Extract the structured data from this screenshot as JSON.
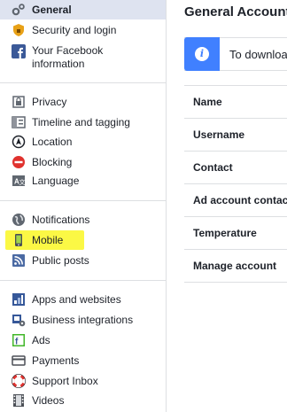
{
  "sidebar": {
    "groups": [
      [
        {
          "label": "General",
          "icon": "gear-icon",
          "selected": true
        },
        {
          "label": "Security and login",
          "icon": "shield-icon"
        },
        {
          "label": "Your Facebook\ninformation",
          "icon": "facebook-icon"
        }
      ],
      [
        {
          "label": "Privacy",
          "icon": "lock-icon"
        },
        {
          "label": "Timeline and tagging",
          "icon": "timeline-icon"
        },
        {
          "label": "Location",
          "icon": "location-icon"
        },
        {
          "label": "Blocking",
          "icon": "block-icon"
        },
        {
          "label": "Language",
          "icon": "language-icon"
        }
      ],
      [
        {
          "label": "Notifications",
          "icon": "globe-icon"
        },
        {
          "label": "Mobile",
          "icon": "mobile-icon",
          "highlighted": true,
          "highlight_color": "#fbf83b"
        },
        {
          "label": "Public posts",
          "icon": "rss-icon"
        }
      ],
      [
        {
          "label": "Apps and websites",
          "icon": "apps-icon"
        },
        {
          "label": "Business integrations",
          "icon": "business-icon"
        },
        {
          "label": "Ads",
          "icon": "ads-icon"
        },
        {
          "label": "Payments",
          "icon": "card-icon"
        },
        {
          "label": "Support Inbox",
          "icon": "lifebuoy-icon"
        },
        {
          "label": "Videos",
          "icon": "film-icon"
        }
      ]
    ]
  },
  "main": {
    "title": "General Account Settings",
    "banner": {
      "text": "To download a copy of your Facebook data, go to Your Facebook Information.",
      "icon": "info-icon",
      "color": "#4080ff"
    },
    "rows": [
      {
        "label": "Name"
      },
      {
        "label": "Username"
      },
      {
        "label": "Contact"
      },
      {
        "label": "Ad account contact"
      },
      {
        "label": "Temperature"
      },
      {
        "label": "Manage account"
      }
    ]
  },
  "colors": {
    "selected_bg": "#dee3f0",
    "divider": "#dddfe2",
    "accent": "#4080ff"
  }
}
